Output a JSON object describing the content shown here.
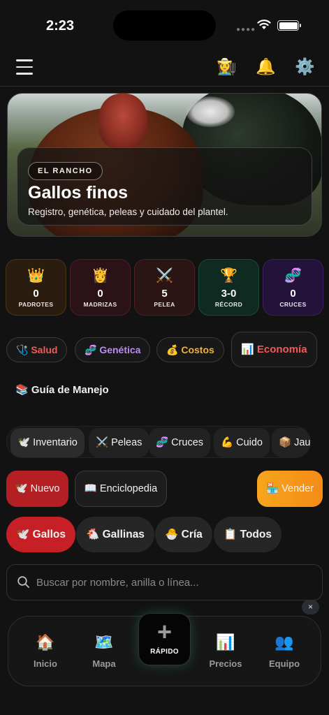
{
  "status_bar": {
    "time": "2:23"
  },
  "header": {
    "farmer_icon": "👩‍🌾",
    "bell_icon": "🔔",
    "settings_icon": "⚙️"
  },
  "hero": {
    "badge": "EL RANCHO",
    "title": "Gallos finos",
    "subtitle": "Registro, genética, peleas y cuidado del plantel."
  },
  "stats": [
    {
      "icon": "👑",
      "value": "0",
      "label": "PADROTES",
      "bg": "#2a1d10",
      "border": "#4a3418"
    },
    {
      "icon": "👸",
      "value": "0",
      "label": "MADRIZAS",
      "bg": "#2a1216",
      "border": "#4a1f27"
    },
    {
      "icon": "⚔️",
      "value": "5",
      "label": "PELEA",
      "bg": "#2a1414",
      "border": "#4a2222"
    },
    {
      "icon": "🏆",
      "value": "3-0",
      "label": "RÉCORD",
      "bg": "#0f2a20",
      "border": "#1d4a38"
    },
    {
      "icon": "🧬",
      "value": "0",
      "label": "CRUCES",
      "bg": "#23123a",
      "border": "#3d1f61"
    }
  ],
  "category_pills": [
    {
      "icon": "🩺",
      "label": "Salud",
      "color": "#f05a5a"
    },
    {
      "icon": "🧬",
      "label": "Genética",
      "color": "#b98cf5"
    },
    {
      "icon": "💰",
      "label": "Costos",
      "color": "#f2b233"
    },
    {
      "icon": "📊",
      "label": "Economía",
      "color": "#f05a5a"
    }
  ],
  "guia": {
    "icon": "📚",
    "label": "Guía de Manejo"
  },
  "tabs": [
    {
      "icon": "🕊️",
      "label": "Inventario"
    },
    {
      "icon": "⚔️",
      "label": "Peleas"
    },
    {
      "icon": "🧬",
      "label": "Cruces"
    },
    {
      "icon": "💪",
      "label": "Cuido"
    },
    {
      "icon": "📦",
      "label": "Jaulas"
    }
  ],
  "actions": {
    "nuevo": {
      "icon": "🕊️",
      "label": "Nuevo"
    },
    "enciclopedia": {
      "icon": "📖",
      "label": "Enciclopedia"
    },
    "vender": {
      "icon": "🏪",
      "label": "Vender"
    }
  },
  "filters": [
    {
      "icon": "🕊️",
      "label": "Gallos"
    },
    {
      "icon": "🐔",
      "label": "Gallinas"
    },
    {
      "icon": "🐣",
      "label": "Cría"
    },
    {
      "icon": "📋",
      "label": "Todos"
    }
  ],
  "search": {
    "placeholder": "Buscar por nombre, anilla o línea..."
  },
  "close_label": "×",
  "bottom_nav": {
    "items": [
      {
        "icon": "🏠",
        "label": "Inicio"
      },
      {
        "icon": "🗺️",
        "label": "Mapa"
      },
      {
        "icon": "📊",
        "label": "Precios"
      },
      {
        "icon": "👥",
        "label": "Equipo"
      }
    ],
    "quick": {
      "plus": "+",
      "label": "RÁPIDO"
    }
  }
}
